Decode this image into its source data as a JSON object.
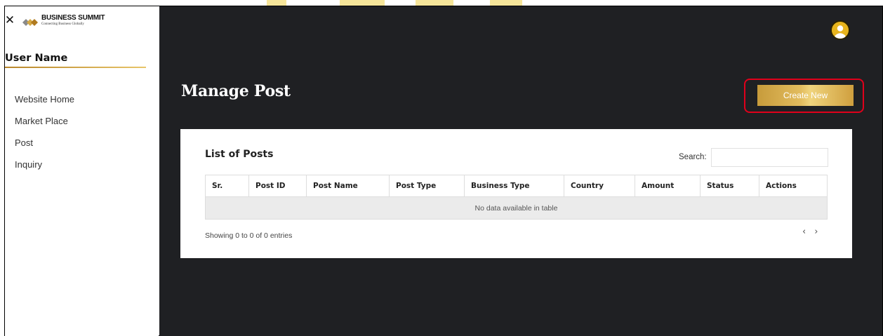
{
  "brand": {
    "title": "BUSINESS SUMMIT",
    "tagline": "Connecting Business Globally",
    "accent": "#d4a843"
  },
  "sidebar": {
    "close_icon": "close-icon",
    "user_name": "User Name",
    "items": [
      {
        "label": "Website Home"
      },
      {
        "label": "Market Place"
      },
      {
        "label": "Post"
      },
      {
        "label": "Inquiry"
      }
    ]
  },
  "header": {
    "avatar_icon": "user-avatar-icon"
  },
  "main": {
    "page_title": "Manage Post",
    "create_button": "Create New",
    "highlight_color": "#e0001b",
    "background": "#1f2023"
  },
  "list": {
    "title": "List of Posts",
    "search_label": "Search:",
    "search_value": "",
    "columns": [
      "Sr.",
      "Post ID",
      "Post Name",
      "Post Type",
      "Business Type",
      "Country",
      "Amount",
      "Status",
      "Actions"
    ],
    "empty_message": "No data available in table",
    "info": "Showing 0 to 0 of 0 entries",
    "prev_label": "‹",
    "next_label": "›"
  }
}
